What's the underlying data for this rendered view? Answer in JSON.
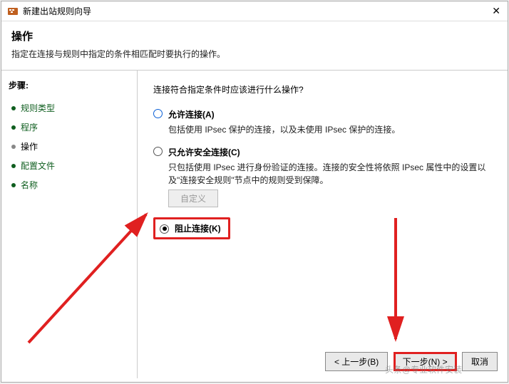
{
  "window": {
    "title": "新建出站规则向导"
  },
  "header": {
    "title": "操作",
    "description": "指定在连接与规则中指定的条件相匹配时要执行的操作。"
  },
  "sidebar": {
    "label": "步骤:",
    "items": [
      {
        "label": "规则类型"
      },
      {
        "label": "程序"
      },
      {
        "label": "操作"
      },
      {
        "label": "配置文件"
      },
      {
        "label": "名称"
      }
    ]
  },
  "content": {
    "question": "连接符合指定条件时应该进行什么操作?",
    "options": [
      {
        "label": "允许连接(A)",
        "desc": "包括使用 IPsec 保护的连接，以及未使用 IPsec 保护的连接。"
      },
      {
        "label": "只允许安全连接(C)",
        "desc": "只包括使用 IPsec 进行身份验证的连接。连接的安全性将依照 IPsec 属性中的设置以及\"连接安全规则\"节点中的规则受到保障。",
        "custom_btn": "自定义"
      },
      {
        "label": "阻止连接(K)"
      }
    ]
  },
  "footer": {
    "back": "< 上一步(B)",
    "next": "下一步(N) >",
    "cancel": "取消"
  },
  "watermark": {
    "main": "头条@专业软件安装"
  }
}
